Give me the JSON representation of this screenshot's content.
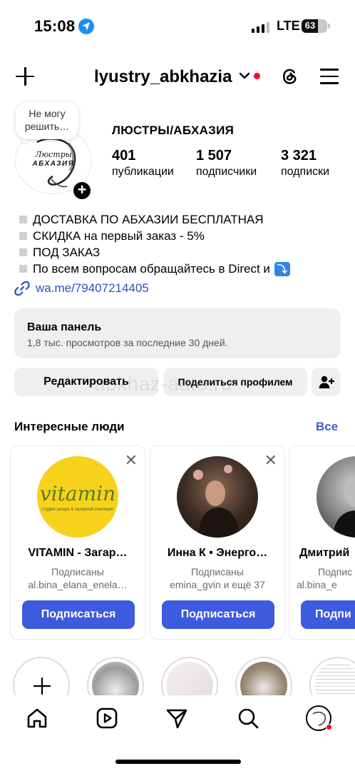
{
  "status_bar": {
    "time": "15:08",
    "network": "LTE",
    "battery": "63"
  },
  "header": {
    "username": "lyustry_abkhazia"
  },
  "profile": {
    "note": "Не могу решить…",
    "avatar_logo_line1": "Люстры",
    "avatar_logo_line2": "АБХАЗИЯ",
    "name": "ЛЮСТРЫ/АБХАЗИЯ",
    "stats": [
      {
        "value": "401",
        "label": "публикации"
      },
      {
        "value": "1 507",
        "label": "подписчики"
      },
      {
        "value": "3 321",
        "label": "подписки"
      }
    ],
    "bio": [
      "ДОСТАВКА ПО АБХАЗИИ БЕСПЛАТНАЯ",
      "СКИДКА на первый заказ - 5%",
      "ПОД ЗАКАЗ",
      "По всем вопросам обращайтесь в Direct и"
    ],
    "bio_arrow": "⤵",
    "link": "wa.me/79407214405"
  },
  "panel": {
    "title": "Ваша панель",
    "subtitle": "1,8 тыс. просмотров за последние 30 дней."
  },
  "actions": {
    "edit": "Редактировать",
    "share": "Поделиться профилем"
  },
  "watermark": "abkhaz-auto.ru",
  "suggested": {
    "title": "Интересные люди",
    "all": "Все",
    "cards": [
      {
        "name": "VITAMIN - Загар…",
        "line1": "Подписаны",
        "line2": "al.bina_elana_enela…",
        "button": "Подписаться",
        "logo_text": "vitamin",
        "logo_sub": "студия загара & лазерной эпиляции"
      },
      {
        "name": "Инна К • Энерго…",
        "line1": "Подписаны",
        "line2": "emina_gvin и ещё 37",
        "button": "Подписаться"
      },
      {
        "name": "Дмитрий",
        "line1": "Подпис",
        "line2": "al.bina_e",
        "button": "Подпи"
      }
    ]
  },
  "colors": {
    "accent": "#3c5bde",
    "link": "#2a52be",
    "notification": "#ff0033"
  },
  "tabbar": [
    "home-icon",
    "reels-icon",
    "direct-icon",
    "search-icon",
    "profile-avatar"
  ]
}
